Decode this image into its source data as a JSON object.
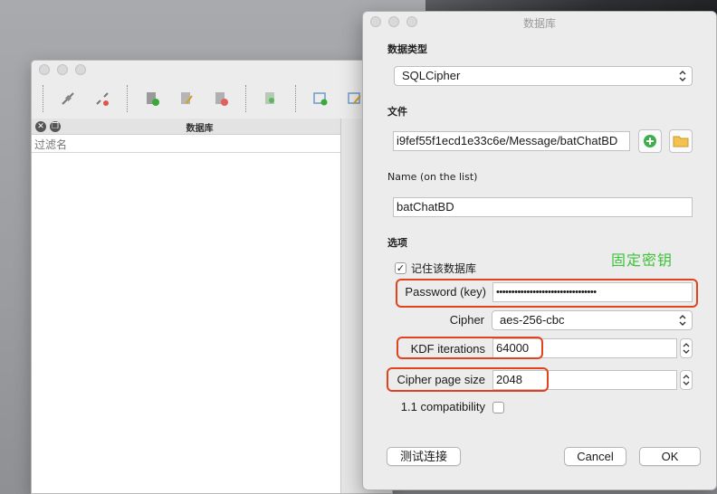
{
  "main_window": {
    "dock_title": "数据库",
    "filter_placeholder": "过滤名"
  },
  "dialog": {
    "title": "数据库",
    "db_type_label": "数据类型",
    "db_type_value": "SQLCipher",
    "file_label": "文件",
    "file_value": "i9fef55f1ecd1e33c6e/Message/batChatBD",
    "name_label": "Name (on the list)",
    "name_value": "batChatBD",
    "options_label": "选项",
    "remember_label": "记住该数据库",
    "remember_checked": true,
    "password_label": "Password (key)",
    "password_value": "•••••••••••••••••••••••••••••••••",
    "cipher_label": "Cipher",
    "cipher_value": "aes-256-cbc",
    "kdf_label": "KDF iterations",
    "kdf_value": "64000",
    "page_size_label": "Cipher page size",
    "page_size_value": "2048",
    "compat_label": "1.1 compatibility",
    "compat_checked": false,
    "test_button": "测试连接",
    "cancel_button": "Cancel",
    "ok_button": "OK"
  },
  "annotation": {
    "text": "固定密钥",
    "color": "#3fc23a",
    "highlight_color": "#e2421e"
  }
}
